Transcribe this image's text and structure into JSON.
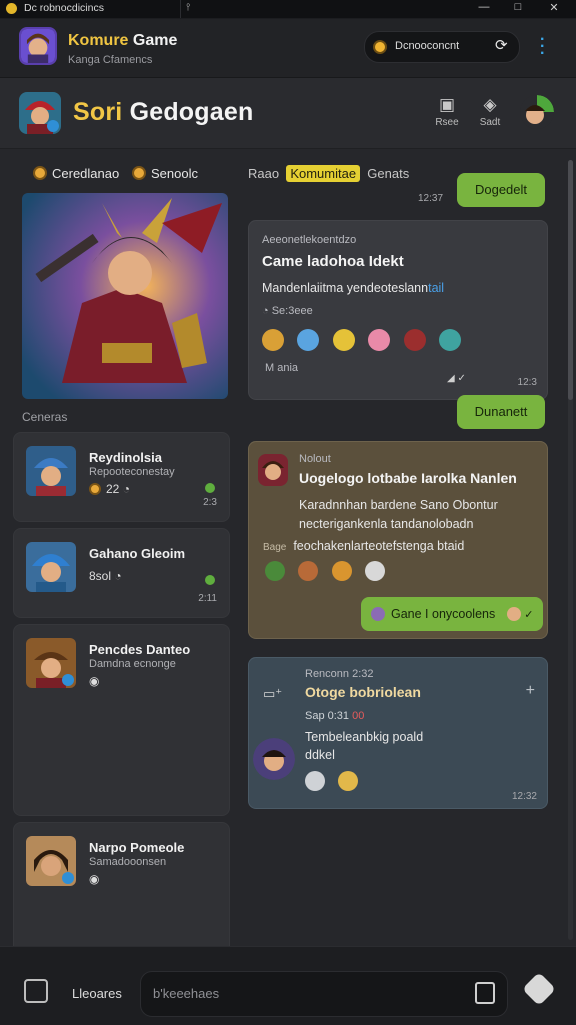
{
  "titlebar": {
    "title": "Dc robnocdicincs",
    "pin_icon": "pin-icon",
    "minimize": "—",
    "maximize": "□",
    "close": "✕"
  },
  "header": {
    "title_accent": "Komure",
    "title_rest": " Game",
    "subtitle": "Kanga Cfamencs",
    "search_text": "Dcnooconcnt",
    "refresh_icon": "⟳"
  },
  "channel": {
    "title_accent": "Sori",
    "title_rest": " Gedogaen",
    "actions": [
      {
        "icon": "camera-icon",
        "label": "Rsee"
      },
      {
        "icon": "shield-icon",
        "label": "Sadt"
      }
    ]
  },
  "left": {
    "tabs": [
      "Ceredlanao",
      "Senoolc"
    ],
    "section_label": "Ceneras",
    "games": [
      {
        "name": "Reydinolsia",
        "meta": "Repooteconestay",
        "stat": "22",
        "time": "2:3"
      },
      {
        "name": "Gahano Gleoim",
        "meta": "",
        "stat": "8sol",
        "time": "2:11"
      },
      {
        "name": "Pencdes Danteo",
        "meta": "Damdna ecnonge",
        "stat": "",
        "time": ""
      },
      {
        "name": "Narpo Pomeole",
        "meta": "Samadooonsen",
        "stat": "",
        "time": ""
      }
    ]
  },
  "feed": {
    "tabs": [
      "Raao",
      "Komumitae",
      "Genats"
    ],
    "button1": "Dogedelt",
    "time1": "12:37",
    "card1": {
      "small": "Aeeonetlekoentdzo",
      "title": "Came ladohoa Idekt",
      "body": "Mandenlaiitma yendeoteslann",
      "body_link": "tail",
      "meta": "Se:3eee",
      "footer": "M ania",
      "time": "12:3"
    },
    "button2": "Dunanett",
    "card2": {
      "small": "Nolout",
      "title": "Uogelogo lotbabe Iarolka Nanlen",
      "line1": "Karadnnhan bardene Sano Obontur",
      "line2": "necterigankenla tandanolobadn",
      "line3_prefix": "Bage",
      "line3": "feochakenlarteotefstenga btaid",
      "chip": "Gane I onycoolens"
    },
    "card3": {
      "small": "Renconn 2:32",
      "title": "Otoge bobriolean",
      "line1": "Sap 0:31",
      "line1_hl": "00",
      "line2": "Tembeleanbkig poald",
      "line2_tail": "ddkel",
      "time": "12:32"
    }
  },
  "bottom": {
    "label": "Lleoares",
    "input_placeholder": "b'keeehaes"
  },
  "colors": {
    "accent": "#f0c542",
    "green": "#79b43f",
    "bg": "#26272b"
  }
}
